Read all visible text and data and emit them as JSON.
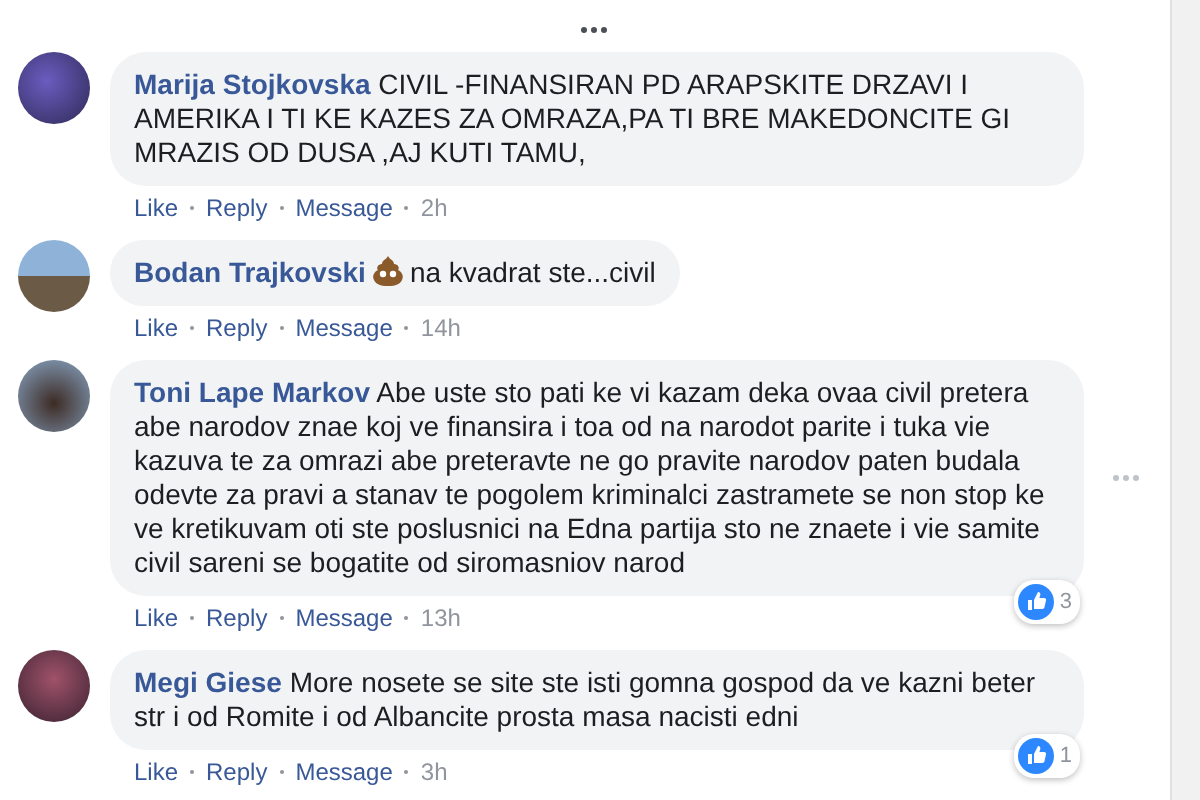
{
  "comments": [
    {
      "kind": "text",
      "name": "Marija Stojkovska",
      "text": "CIVIL -FINANSIRAN PD ARAPSKITE DRZAVI I AMERIKA I TI KE KAZES ZA OMRAZA,PA TI BRE MAKEDONCITE GI MRAZIS OD DUSA ,AJ KUTI TAMU,",
      "actions": [
        "Like",
        "Reply",
        "Message"
      ],
      "time": "2h",
      "show_options": false
    },
    {
      "kind": "emoji_text",
      "name": "Bodan Trajkovski",
      "text": "na kvadrat ste...civil",
      "actions": [
        "Like",
        "Reply",
        "Message"
      ],
      "time": "14h",
      "show_options": false
    },
    {
      "kind": "text",
      "name": "Toni Lape Markov",
      "text": "Abe uste sto pati ke vi kazam deka ovaa civil pretera abe narodov znae koj ve finansira i toa od na narodot parite i tuka vie kazuva te za omrazi abe preteravte ne go pravite narodov paten budala odevte za pravi a stanav te pogolem kriminalci zastramete se non stop ke ve kretikuvam oti ste poslusnici na Edna partija sto ne znaete i vie samite civil sareni se bogatite od siromasniov narod",
      "actions": [
        "Like",
        "Reply",
        "Message"
      ],
      "time": "13h",
      "reactions": "3",
      "show_options": true
    },
    {
      "kind": "text",
      "name": "Megi Giese",
      "text": "More nosete se site ste isti gomna gospod da ve kazni beter str i od Romite i od Albancite prosta masa nacisti edni",
      "actions": [
        "Like",
        "Reply",
        "Message"
      ],
      "time": "3h",
      "reactions": "1",
      "show_options": false
    }
  ]
}
